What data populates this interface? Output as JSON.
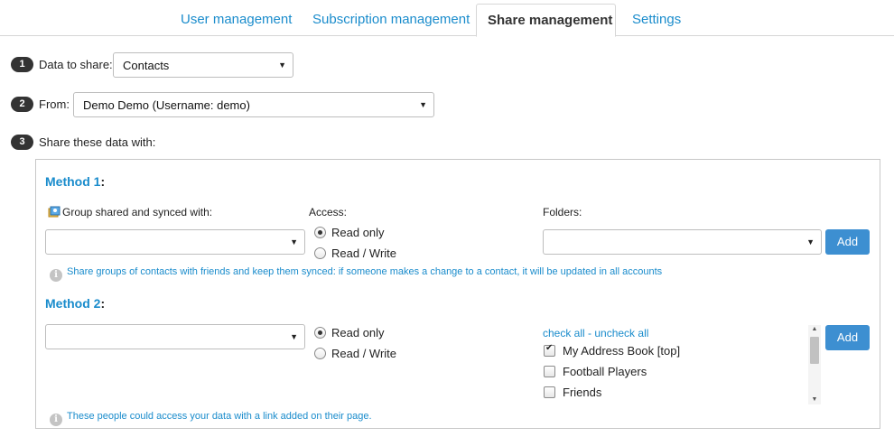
{
  "tabs": {
    "user_management": "User management",
    "subscription_management": "Subscription management",
    "share_management": "Share management",
    "settings": "Settings"
  },
  "steps": {
    "step1": {
      "number": "1",
      "label": "Data to share:",
      "selected": "Contacts"
    },
    "step2": {
      "number": "2",
      "label": "From:",
      "selected": "Demo Demo (Username: demo)"
    },
    "step3": {
      "number": "3",
      "label": "Share these data with:"
    }
  },
  "method1": {
    "title": "Method 1",
    "colon": ":",
    "group_label": "Group shared and synced with:",
    "group_selected": "",
    "access_label": "Access:",
    "access_options": [
      "Read only",
      "Read / Write"
    ],
    "access_selected": "Read only",
    "folders_label": "Folders:",
    "folders_selected": "",
    "add_button": "Add",
    "info": "Share groups of contacts with friends and keep them synced: if someone makes a change to a contact, it will be updated in all accounts"
  },
  "method2": {
    "title": "Method 2",
    "colon": ":",
    "selected": "",
    "access_options": [
      "Read only",
      "Read / Write"
    ],
    "access_selected": "Read only",
    "check_all": "check all",
    "separator": " - ",
    "uncheck_all": "uncheck all",
    "folders": [
      {
        "label": "My Address Book [top]",
        "checked": true
      },
      {
        "label": "Football Players",
        "checked": false
      },
      {
        "label": "Friends",
        "checked": false
      }
    ],
    "add_button": "Add",
    "info": "These people could access your data with a link added on their page."
  },
  "colors": {
    "accent": "#1a8ccc",
    "button": "#3d8fd1",
    "badge": "#333333"
  },
  "icons": {
    "caret": "▼",
    "info": "i",
    "group": "group-share-icon",
    "scroll_up": "▲",
    "scroll_down": "▼"
  }
}
